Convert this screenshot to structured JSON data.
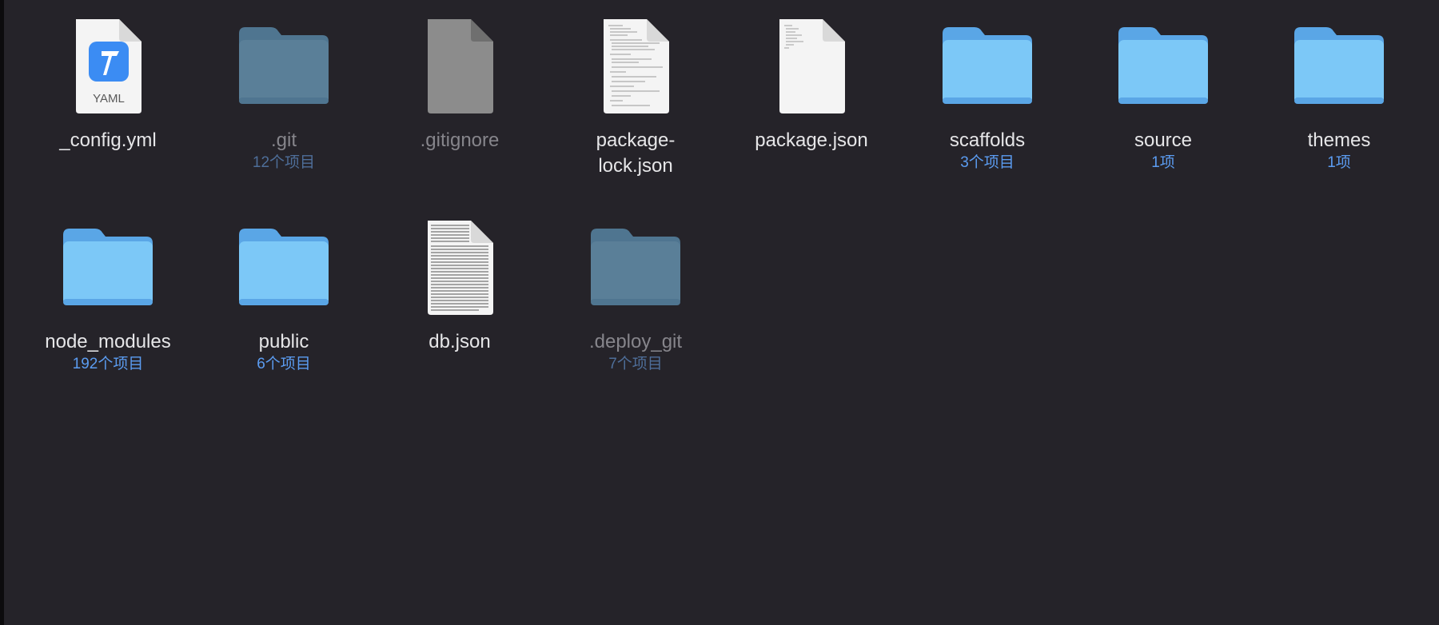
{
  "window": {
    "view": "icon-view"
  },
  "colors": {
    "background": "#252329",
    "folder": "#7cc8f7",
    "folder_dim": "#5a7f98",
    "file_label": "#e6e6e8",
    "hidden_label": "#86858b",
    "count_label": "#5b9cf1"
  },
  "items": [
    {
      "name": "_config.yml",
      "count": "",
      "kind": "yaml-file",
      "icon_text": "YAML"
    },
    {
      "name": ".git",
      "count": "12个项目",
      "kind": "folder-hidden"
    },
    {
      "name": ".gitignore",
      "count": "",
      "kind": "file-hidden"
    },
    {
      "name": "package-\nlock.json",
      "count": "",
      "kind": "text-file"
    },
    {
      "name": "package.json",
      "count": "",
      "kind": "text-file"
    },
    {
      "name": "scaffolds",
      "count": "3个项目",
      "kind": "folder"
    },
    {
      "name": "source",
      "count": "1项",
      "kind": "folder"
    },
    {
      "name": "themes",
      "count": "1项",
      "kind": "folder"
    },
    {
      "name": "node_modules",
      "count": "192个项目",
      "kind": "folder"
    },
    {
      "name": "public",
      "count": "6个项目",
      "kind": "folder"
    },
    {
      "name": "db.json",
      "count": "",
      "kind": "text-file-dense"
    },
    {
      "name": ".deploy_git",
      "count": "7个项目",
      "kind": "folder-hidden"
    }
  ]
}
